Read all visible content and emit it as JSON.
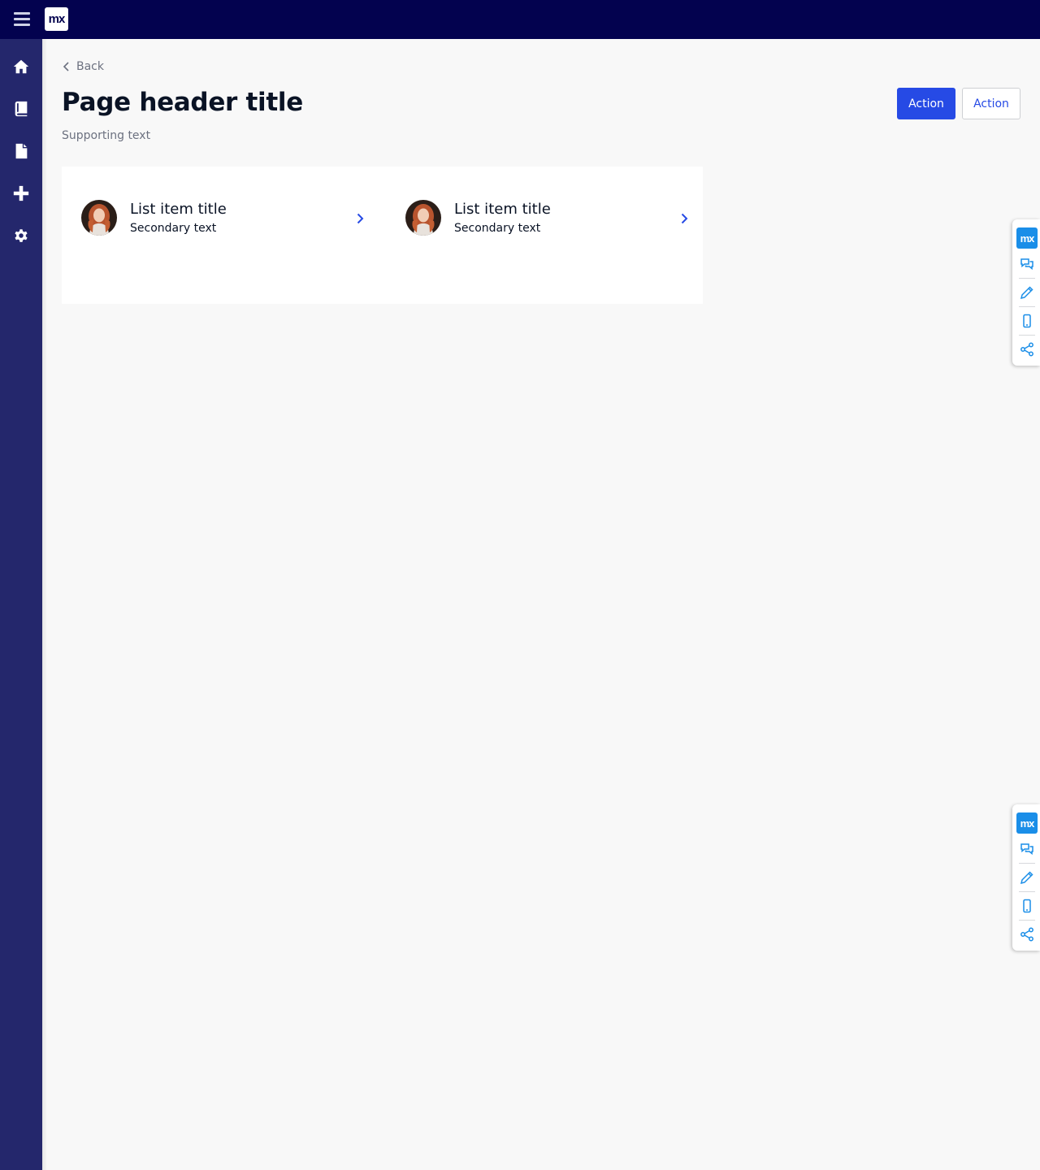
{
  "topbar": {
    "logo_text": "mx"
  },
  "sidebar": {
    "items": [
      {
        "name": "home"
      },
      {
        "name": "book"
      },
      {
        "name": "file"
      },
      {
        "name": "plus"
      },
      {
        "name": "settings"
      }
    ]
  },
  "header": {
    "back_label": "Back",
    "title": "Page header title",
    "supporting_text": "Supporting text",
    "primary_action": "Action",
    "secondary_action": "Action"
  },
  "list": {
    "items": [
      {
        "title": "List item title",
        "secondary": "Secondary text"
      },
      {
        "title": "List item title",
        "secondary": "Secondary text"
      }
    ]
  },
  "mx_widget": {
    "logo_text": "mx",
    "tools": [
      "feedback-icon",
      "edit-icon",
      "mobile-icon",
      "share-icon"
    ]
  },
  "colors": {
    "topbar": "#03024f",
    "sidebar": "#24276c",
    "primary": "#264ae5",
    "widget_accent": "#1a8ee8"
  }
}
